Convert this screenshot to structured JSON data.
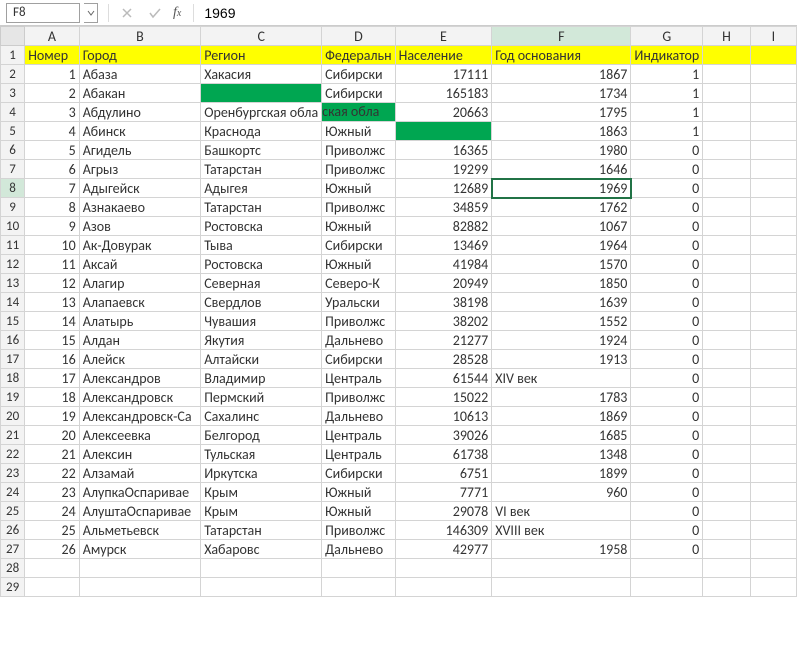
{
  "nameBox": "F8",
  "formulaValue": "1969",
  "activeCell": {
    "row": 8,
    "col": "F"
  },
  "columns": [
    "A",
    "B",
    "C",
    "D",
    "E",
    "F",
    "G",
    "H",
    "I"
  ],
  "headerRow": {
    "A": "Номер",
    "B": "Город",
    "C": "Регион",
    "D": "Федеральн",
    "E": "Население",
    "F": "Год основания",
    "G": "Индикатор"
  },
  "chart_data": {
    "type": "table",
    "columns": [
      "Номер",
      "Город",
      "Регион",
      "Федеральный округ",
      "Население",
      "Год основания",
      "Индикатор"
    ],
    "rows": [
      [
        1,
        "Абаза",
        "Хакасия",
        "Сибирски",
        17111,
        1867,
        1
      ],
      [
        2,
        "Абакан",
        "",
        "Сибирски",
        165183,
        1734,
        1
      ],
      [
        3,
        "Абдулино",
        "Оренбургская обла",
        "",
        20663,
        1795,
        1
      ],
      [
        4,
        "Абинск",
        "Краснода",
        "Южный",
        "",
        1863,
        1
      ],
      [
        5,
        "Агидель",
        "Башкортс",
        "Приволжс",
        16365,
        1980,
        0
      ],
      [
        6,
        "Агрыз",
        "Татарстан",
        "Приволжс",
        19299,
        1646,
        0
      ],
      [
        7,
        "Адыгейск",
        "Адыгея",
        "Южный",
        12689,
        1969,
        0
      ],
      [
        8,
        "Азнакаево",
        "Татарстан",
        "Приволжс",
        34859,
        1762,
        0
      ],
      [
        9,
        "Азов",
        "Ростовска",
        "Южный",
        82882,
        1067,
        0
      ],
      [
        10,
        "Ак-Довурак",
        "Тыва",
        "Сибирски",
        13469,
        1964,
        0
      ],
      [
        11,
        "Аксай",
        "Ростовска",
        "Южный",
        41984,
        1570,
        0
      ],
      [
        12,
        "Алагир",
        "Северная",
        "Северо-К",
        20949,
        1850,
        0
      ],
      [
        13,
        "Алапаевск",
        "Свердлов",
        "Уральски",
        38198,
        1639,
        0
      ],
      [
        14,
        "Алатырь",
        "Чувашия",
        "Приволжс",
        38202,
        1552,
        0
      ],
      [
        15,
        "Алдан",
        "Якутия",
        "Дальнево",
        21277,
        1924,
        0
      ],
      [
        16,
        "Алейск",
        "Алтайски",
        "Сибирски",
        28528,
        1913,
        0
      ],
      [
        17,
        "Александров",
        "Владимир",
        "Централь",
        61544,
        "XIV век",
        0
      ],
      [
        18,
        "Александровск",
        "Пермский",
        "Приволжс",
        15022,
        1783,
        0
      ],
      [
        19,
        "Александровск-Са",
        "Сахалинс",
        "Дальнево",
        10613,
        1869,
        0
      ],
      [
        20,
        "Алексеевка",
        "Белгород",
        "Централь",
        39026,
        1685,
        0
      ],
      [
        21,
        "Алексин",
        "Тульская",
        "Централь",
        61738,
        1348,
        0
      ],
      [
        22,
        "Алзамай",
        "Иркутска",
        "Сибирски",
        6751,
        1899,
        0
      ],
      [
        23,
        "АлупкаОспаривае",
        "Крым",
        "Южный",
        7771,
        960,
        0
      ],
      [
        24,
        "АлуштаОспаривае",
        "Крым",
        "Южный",
        29078,
        "VI век",
        0
      ],
      [
        25,
        "Альметьевск",
        "Татарстан",
        "Приволжс",
        146309,
        "XVIII век",
        0
      ],
      [
        26,
        "Амурск",
        "Хабаровс",
        "Дальнево",
        42977,
        1958,
        0
      ]
    ]
  },
  "greenCells": [
    {
      "row": 3,
      "col": "C"
    },
    {
      "row": 4,
      "col": "D"
    },
    {
      "row": 5,
      "col": "E"
    }
  ],
  "overflowRow4": "ская обла"
}
